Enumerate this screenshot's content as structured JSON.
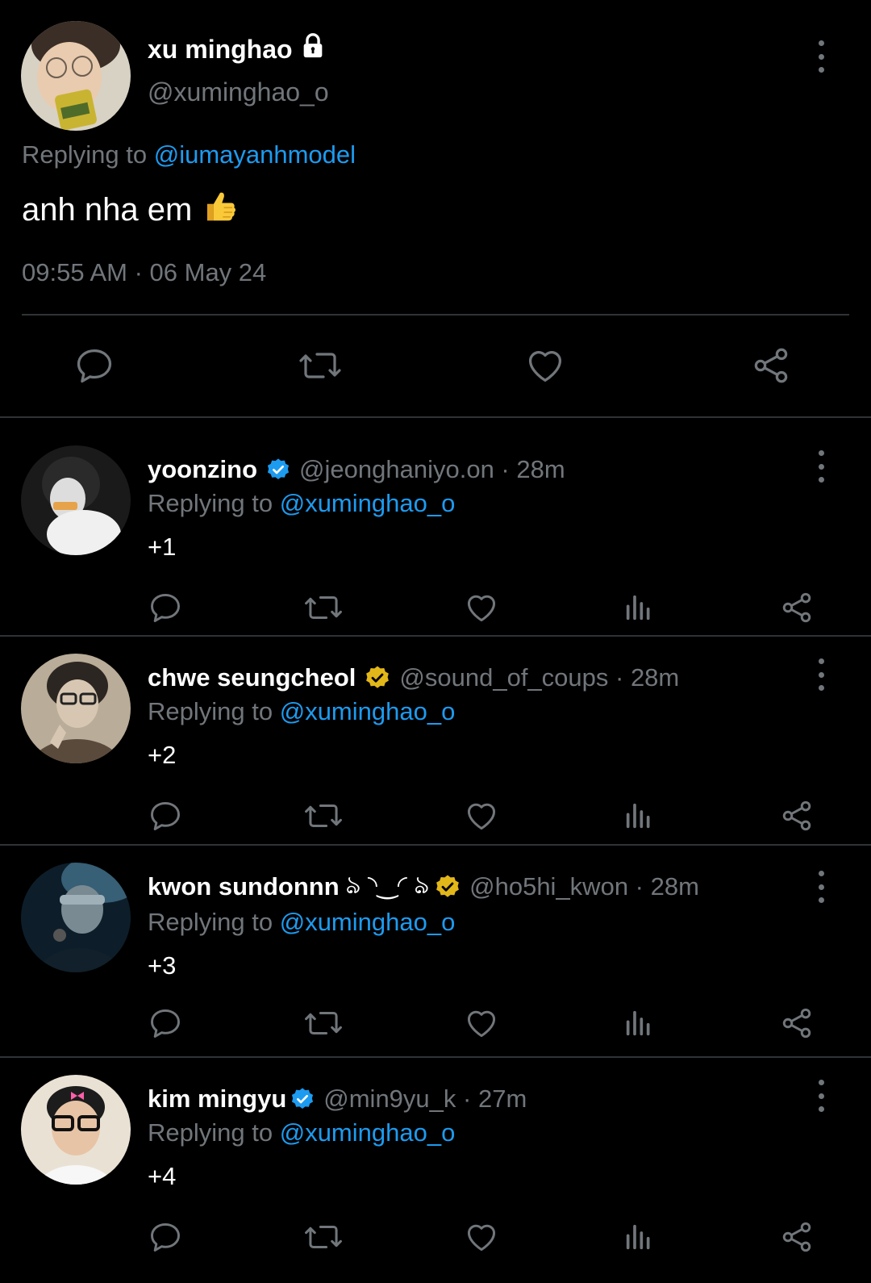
{
  "main_tweet": {
    "name": "xu minghao",
    "handle": "@xuminghao_o",
    "replying_prefix": "Replying to",
    "replying_to": "@iumayanhmodel",
    "text": "anh nha em",
    "emoji": "👍",
    "timestamp": "09:55 AM · 06 May 24",
    "icons": [
      "lock-icon",
      "reply-icon",
      "retweet-icon",
      "like-icon",
      "share-icon",
      "more-icon"
    ]
  },
  "replies": [
    {
      "name": "yoonzino",
      "badge": "blue",
      "meta": "@jeonghaniyo.on · 28m",
      "replying_prefix": "Replying to",
      "replying_to": "@xuminghao_o",
      "text": "+1"
    },
    {
      "name": "chwe seungcheol",
      "badge": "gold",
      "meta": "@sound_of_coups · 28m",
      "replying_prefix": "Replying to",
      "replying_to": "@xuminghao_o",
      "text": "+2"
    },
    {
      "name": "kwon sundonnn",
      "kaomoji": "ঌ ◝‿◜ ঌ",
      "badge": "gold",
      "meta": "@ho5hi_kwon · 28m",
      "replying_prefix": "Replying to",
      "replying_to": "@xuminghao_o",
      "text": "+3"
    },
    {
      "name": "kim mingyu",
      "badge": "blue",
      "meta": "@min9yu_k · 27m",
      "replying_prefix": "Replying to",
      "replying_to": "@xuminghao_o",
      "text": "+4"
    }
  ],
  "colors": {
    "background": "#000000",
    "text": "#e7e9ea",
    "muted": "#71767b",
    "link": "#1d9bf0",
    "verified_blue": "#1d9bf0",
    "verified_gold": "#e2b719",
    "divider": "#2f3336"
  }
}
